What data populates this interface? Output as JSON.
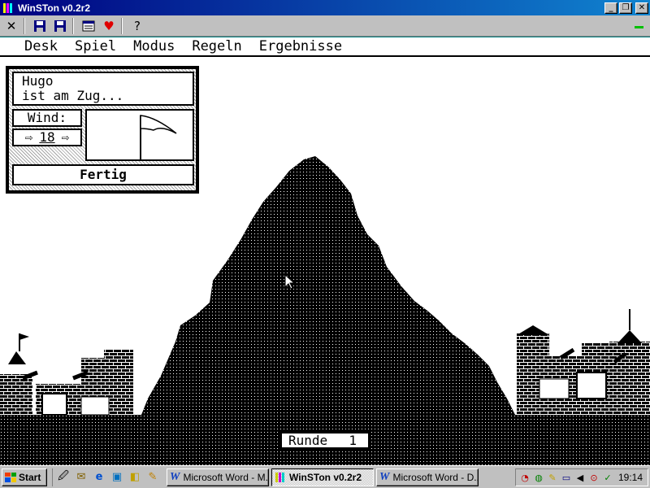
{
  "window": {
    "title": "WinSTon v0.2r2",
    "buttons": [
      "minimize",
      "maximize",
      "close"
    ]
  },
  "toolbar": {
    "tools": [
      "close-x-icon",
      "save-icon",
      "save-as-icon",
      "settings-icon",
      "heart-icon",
      "help-icon"
    ],
    "help_label": "?"
  },
  "menu": {
    "items": [
      "Desk",
      "Spiel",
      "Modus",
      "Regeln",
      "Ergebnisse"
    ]
  },
  "panel": {
    "player_line1": "Hugo",
    "player_line2": "ist am Zug...",
    "wind_label": "Wind:",
    "wind_value": "18",
    "wind_arrow_left": "⇨",
    "wind_arrow_right": "⇨",
    "done_button": "Fertig"
  },
  "status": {
    "round_label": "Runde",
    "round_value": "1"
  },
  "taskbar": {
    "start_label": "Start",
    "quick_launch": [
      "desktop-icon",
      "outlook-icon",
      "ie-icon",
      "channels-icon",
      "explorer-icon",
      "edit-icon"
    ],
    "tasks": [
      {
        "label": "Microsoft Word - M...",
        "active": false
      },
      {
        "label": "WinSTon v0.2r2",
        "active": true
      },
      {
        "label": "Microsoft Word - D...",
        "active": false
      }
    ],
    "clock": "19:14"
  },
  "colors": {
    "titlebar_start": "#000080",
    "titlebar_end": "#1084d0",
    "taskbar": "#c0c0c0",
    "desktop": "#008080"
  }
}
